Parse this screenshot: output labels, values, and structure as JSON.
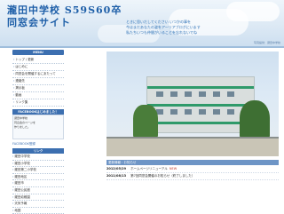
{
  "header": {
    "title_line1": "瀧田中学校 S59S60卒",
    "title_line2": "同窓会サイト",
    "message_lines": [
      "ときに思いだしてください いつかの事を",
      "今はまだあなたの姿をアーリアブログにいます",
      "私たちいつも仲間がいることを忘れないでね"
    ],
    "note": "写真提供：瀧田中学校"
  },
  "sidebar": {
    "menu_heading": "MENU",
    "menu_items": [
      "トップ / 更新",
      "はじめに",
      "同窓会を開催するにあたって",
      "連絡先",
      "掲示板",
      "動画",
      "リンク集"
    ],
    "facebook_heading": "FACEBOOKはじめました！",
    "facebook_text": [
      "瀧田中学校",
      "同窓会のページを",
      "作りました。"
    ],
    "facebook_link": "FACEBOOK登録",
    "links_heading": "リンク",
    "link_items": [
      "瀧田中学校",
      "瀧田小学校",
      "瀧田第二小学校",
      "瀧田地区",
      "瀧田市",
      "瀧田公民館",
      "瀧田幼稚園",
      "天気予報",
      "地図"
    ]
  },
  "main": {
    "news_heading": "更新情報・お知らせ",
    "news": [
      {
        "date": "2012/05/29",
        "text": "ホームページリニューアル",
        "badge": "NEW"
      },
      {
        "date": "2011/08/13",
        "text": "第7回同窓会開催のお知らせ（終了しました）",
        "badge": ""
      }
    ]
  }
}
